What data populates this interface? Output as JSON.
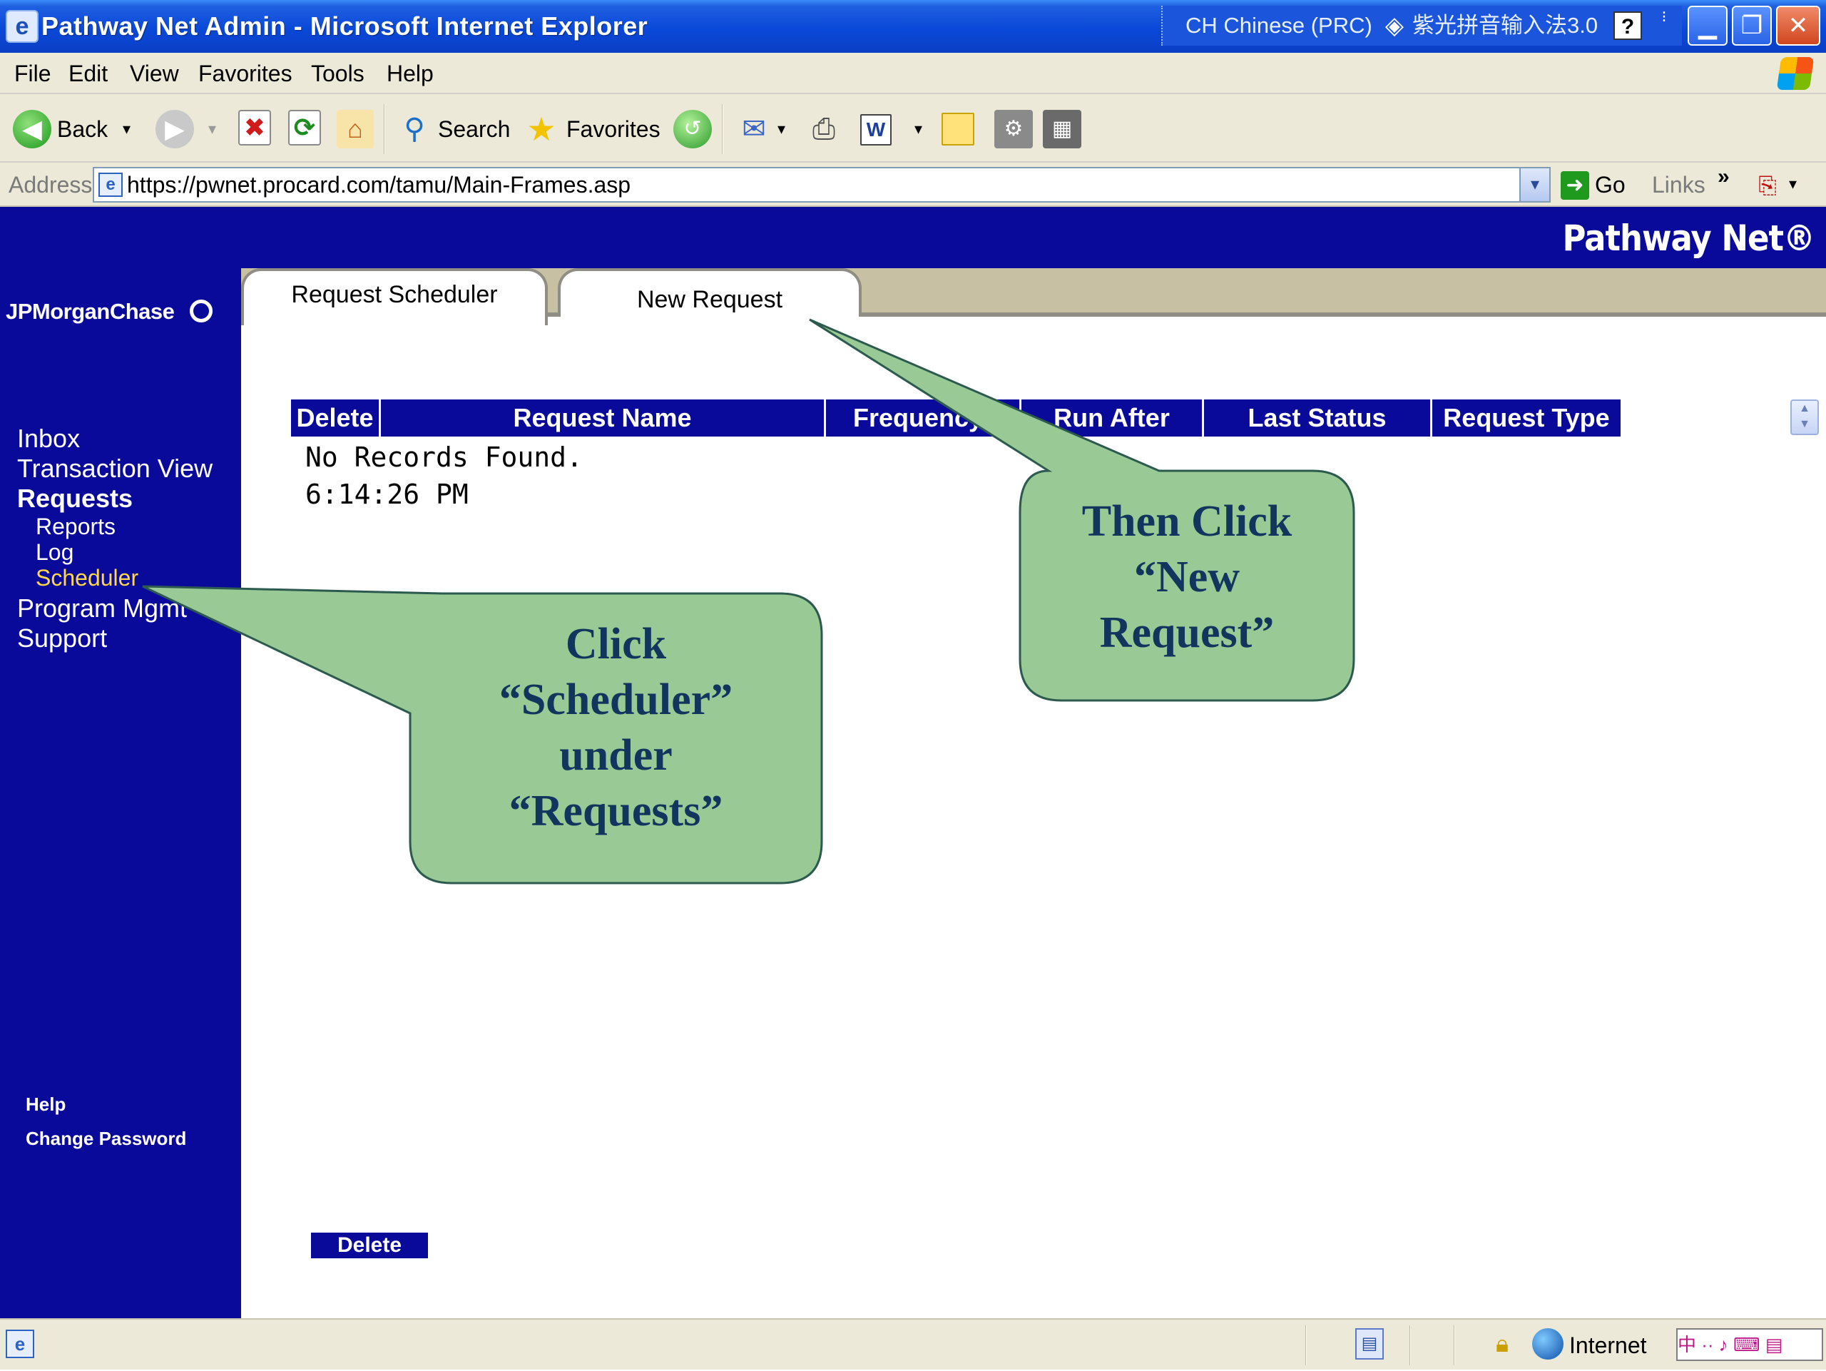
{
  "window": {
    "title": "Pathway Net Admin - Microsoft Internet Explorer",
    "language_indicator": "CH Chinese (PRC)",
    "ime_name": "紫光拼音输入法3.0",
    "ime_help": "?",
    "ime_arrows": "⁝",
    "minimize": "▁",
    "maximize": "❐",
    "close": "✕"
  },
  "menu": {
    "file": "File",
    "edit": "Edit",
    "view": "View",
    "favorites": "Favorites",
    "tools": "Tools",
    "help": "Help"
  },
  "toolbar": {
    "back_label": "Back",
    "search_label": "Search",
    "favorites_label": "Favorites",
    "dropdown_arrow": "▾"
  },
  "address": {
    "label": "Address",
    "url": "https://pwnet.procard.com/tamu/Main-Frames.asp",
    "go_label": "Go",
    "links_label": "Links",
    "links_chevron": "»"
  },
  "brand": {
    "product": "Pathway Net®",
    "bank": "JPMorganChase"
  },
  "sidebar": {
    "inbox": "Inbox",
    "transaction_view": "Transaction View",
    "requests": "Requests",
    "reports": "Reports",
    "log": "Log",
    "scheduler": "Scheduler",
    "program_mgmt": "Program Mgmt",
    "support": "Support",
    "help": "Help",
    "change_password": "Change Password"
  },
  "tabs": {
    "active": "Request Scheduler",
    "new_request": "New Request"
  },
  "table": {
    "columns": [
      "Delete",
      "Request Name",
      "Frequency",
      "Run After",
      "Last Status",
      "Request Type"
    ],
    "empty_message": "No Records Found.",
    "time": "6:14:26 PM"
  },
  "buttons": {
    "delete": "Delete"
  },
  "status": {
    "zone": "Internet",
    "ime_bar": "中 ·· ♪ ⌨ ▤"
  },
  "callouts": {
    "scheduler": [
      "Click",
      "“Scheduler”",
      "under",
      "“Requests”"
    ],
    "new_request": [
      "Then Click",
      "“New",
      "Request”"
    ]
  },
  "colors": {
    "navy": "#0a0a9a",
    "sidebar_active": "#ffd84a",
    "callout_fill": "#99c995",
    "callout_stroke": "#2c5a4f",
    "callout_text": "#12355e"
  }
}
